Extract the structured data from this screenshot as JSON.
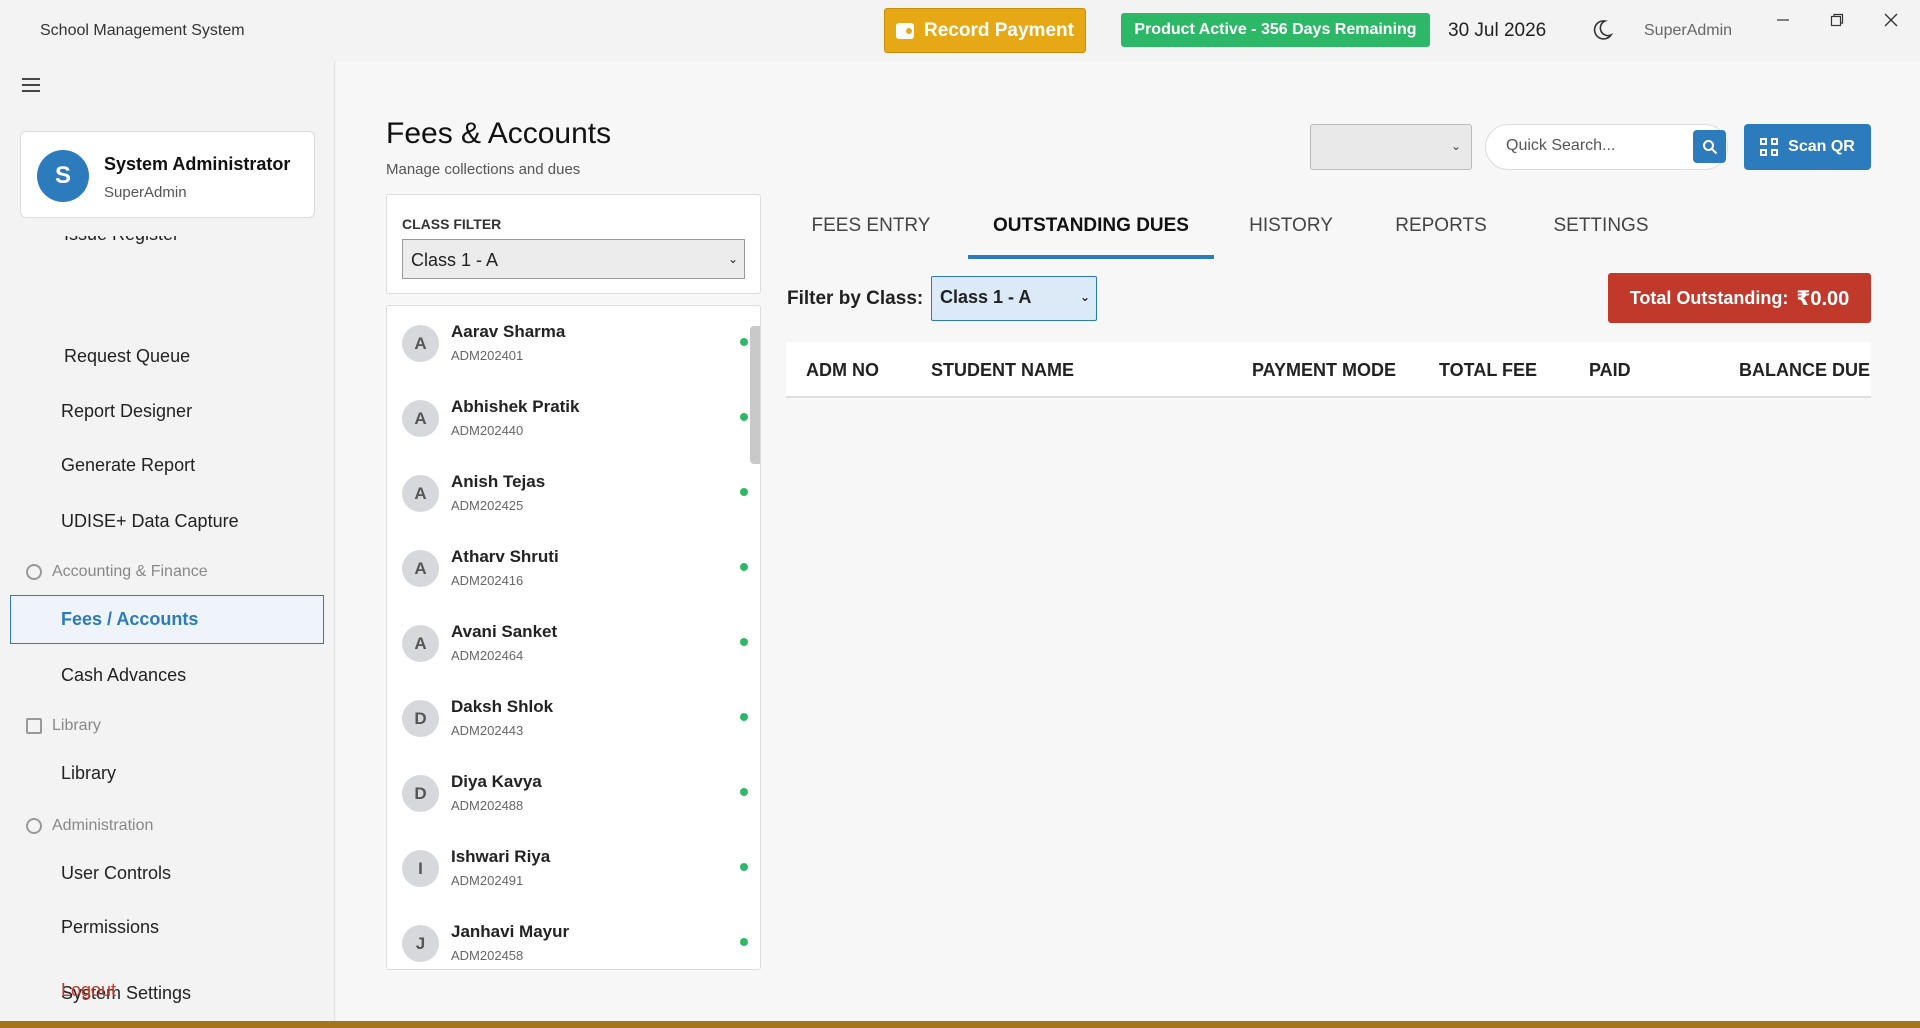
{
  "app": {
    "title": "School Management System",
    "record_payment_label": "Record Payment",
    "license_status": "Product Active - 356 Days Remaining",
    "date": "30 Jul 2026",
    "user_role": "SuperAdmin"
  },
  "sidebar": {
    "profile": {
      "initial": "S",
      "name": "System Administrator",
      "role": "SuperAdmin"
    },
    "cut_item": "Issue Register",
    "items": {
      "request_queue": "Request Queue",
      "report_designer": "Report Designer",
      "generate_report": "Generate Report",
      "udise": "UDISE+ Data Capture",
      "accounting_section": "Accounting & Finance",
      "fees_accounts": "Fees / Accounts",
      "cash_advances": "Cash Advances",
      "library_section": "Library",
      "library": "Library",
      "admin_section": "Administration",
      "user_controls": "User Controls",
      "permissions": "Permissions",
      "system_settings": "System Settings",
      "logout": "Logout"
    }
  },
  "header": {
    "title": "Fees & Accounts",
    "subtitle": "Manage collections and dues",
    "search_placeholder": "Quick Search...",
    "scan_label": "Scan QR"
  },
  "class_filter": {
    "label": "CLASS FILTER",
    "selected": "Class 1 - A"
  },
  "students": [
    {
      "initial": "A",
      "name": "Aarav Sharma",
      "id": "ADM202401"
    },
    {
      "initial": "A",
      "name": "Abhishek Pratik",
      "id": "ADM202440"
    },
    {
      "initial": "A",
      "name": "Anish Tejas",
      "id": "ADM202425"
    },
    {
      "initial": "A",
      "name": "Atharv Shruti",
      "id": "ADM202416"
    },
    {
      "initial": "A",
      "name": "Avani Sanket",
      "id": "ADM202464"
    },
    {
      "initial": "D",
      "name": "Daksh Shlok",
      "id": "ADM202443"
    },
    {
      "initial": "D",
      "name": "Diya Kavya",
      "id": "ADM202488"
    },
    {
      "initial": "I",
      "name": "Ishwari Riya",
      "id": "ADM202491"
    },
    {
      "initial": "J",
      "name": "Janhavi Mayur",
      "id": "ADM202458"
    }
  ],
  "tabs": [
    {
      "label": "FEES ENTRY"
    },
    {
      "label": "OUTSTANDING DUES"
    },
    {
      "label": "HISTORY"
    },
    {
      "label": "REPORTS"
    },
    {
      "label": "SETTINGS"
    }
  ],
  "dues": {
    "filter_label": "Filter by Class:",
    "filter_selected": "Class 1 - A",
    "total_label": "Total Outstanding:",
    "total_amount": "₹0.00",
    "columns": [
      "ADM NO",
      "STUDENT NAME",
      "PAYMENT MODE",
      "TOTAL FEE",
      "PAID",
      "BALANCE DUE"
    ]
  },
  "colors": {
    "accent": "#2b7bbd",
    "warning": "#e6a915",
    "success": "#2db868",
    "danger": "#c0392b"
  }
}
